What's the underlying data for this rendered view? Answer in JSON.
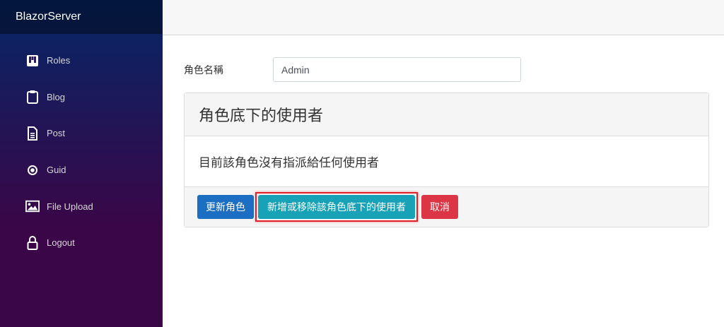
{
  "brand": "BlazorServer",
  "nav": [
    {
      "label": "Roles",
      "icon": "roles-icon"
    },
    {
      "label": "Blog",
      "icon": "clipboard-icon"
    },
    {
      "label": "Post",
      "icon": "document-icon"
    },
    {
      "label": "Guid",
      "icon": "radio-circle-icon"
    },
    {
      "label": "File Upload",
      "icon": "image-icon"
    },
    {
      "label": "Logout",
      "icon": "lock-icon"
    }
  ],
  "form": {
    "role_name_label": "角色名稱",
    "role_name_value": "Admin"
  },
  "card": {
    "header": "角色底下的使用者",
    "body": "目前該角色沒有指派給任何使用者"
  },
  "buttons": {
    "update": "更新角色",
    "manage_users": "新增或移除該角色底下的使用者",
    "cancel": "取消"
  },
  "colors": {
    "primary": "#1b6ec2",
    "info": "#17a2b8",
    "danger": "#dc3545",
    "highlight": "#e2202a"
  }
}
